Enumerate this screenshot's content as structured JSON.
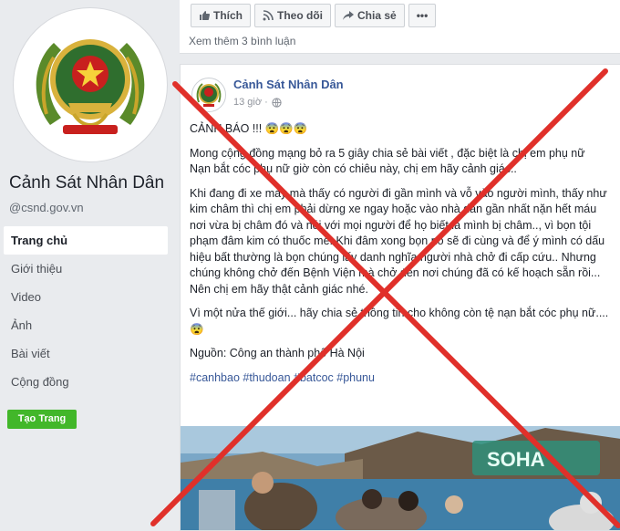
{
  "sidebar": {
    "page_name": "Cảnh Sát Nhân Dân",
    "handle": "@csnd.gov.vn",
    "nav": [
      "Trang chủ",
      "Giới thiệu",
      "Video",
      "Ảnh",
      "Bài viết",
      "Cộng đồng"
    ],
    "create_page": "Tạo Trang"
  },
  "topcard": {
    "like": "Thích",
    "follow": "Theo dõi",
    "share": "Chia sẻ",
    "more": "•••",
    "more_comments": "Xem thêm 3 bình luận"
  },
  "post": {
    "author": "Cảnh Sát Nhân Dân",
    "time": "13 giờ ·",
    "p1": "CẢNH BÁO !!! 😨😨😨",
    "p2": "Mong cộng đồng mạng bỏ ra 5 giây chia sẻ bài viết , đặc biệt là chị em phụ nữ",
    "p3": "Nạn bắt cóc phụ nữ giờ còn có chiêu này, chị em hãy cảnh giác..",
    "p4": "Khi đang đi xe máy mà thấy có người đi gần mình và vỗ vào người mình, thấy như kim châm thì chị em phải dừng xe ngay hoặc vào nhà dân gần nhất nặn hết máu nơi vừa bị châm đó và nói với mọi người để họ biết là mình bị châm.., vì bọn tội phạm đâm kim có thuốc mê. Khi đâm xong bọn nó sẽ đi cùng và để ý mình có dấu hiệu bất thường là bọn chúng lấy danh nghĩa người nhà chở đi cấp cứu.. Nhưng chúng không chở đến Bệnh Viện mà chở đến nơi chúng đã có kế hoạch sẵn rồi... Nên chị em hãy thật cảnh giác nhé.",
    "p5": "Vì một nửa thế giới... hãy chia sẻ thông tin cho không còn tệ nạn bắt cóc phụ nữ....😨",
    "source": "Nguồn: Công an thành phố Hà Nội",
    "tags": "#canhbao #thudoan #batcoc #phunu",
    "photo_watermark": "SOHA"
  },
  "colors": {
    "cross": "#e0302a",
    "link": "#385898",
    "button_green": "#42b72a"
  }
}
